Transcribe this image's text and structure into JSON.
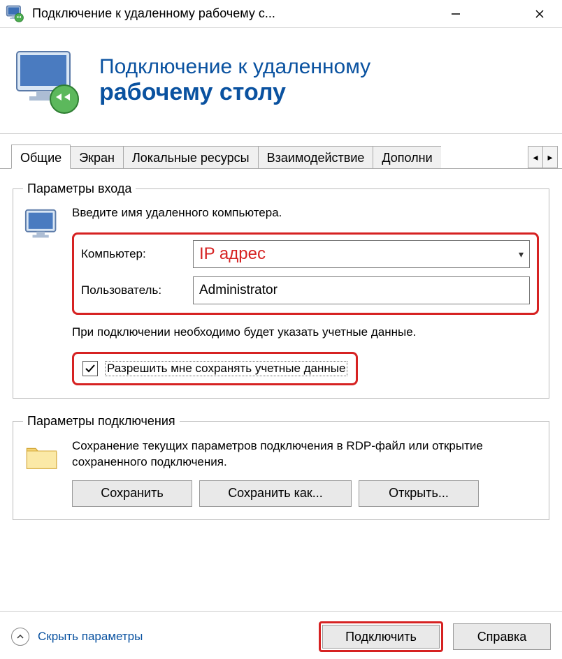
{
  "window": {
    "title": "Подключение к удаленному рабочему с..."
  },
  "header": {
    "line1": "Подключение к удаленному",
    "line2": "рабочему столу"
  },
  "tabs": [
    "Общие",
    "Экран",
    "Локальные ресурсы",
    "Взаимодействие",
    "Дополни"
  ],
  "login_group": {
    "legend": "Параметры входа",
    "instruction": "Введите имя удаленного компьютера.",
    "computer_label": "Компьютер:",
    "computer_value": "IP адрес",
    "user_label": "Пользователь:",
    "user_value": "Administrator",
    "note": "При подключении необходимо будет указать учетные данные.",
    "save_creds_label": "Разрешить мне сохранять учетные данные"
  },
  "conn_group": {
    "legend": "Параметры подключения",
    "desc": "Сохранение текущих параметров подключения в RDP-файл или открытие сохраненного подключения.",
    "save": "Сохранить",
    "save_as": "Сохранить как...",
    "open": "Открыть..."
  },
  "footer": {
    "hide": "Скрыть параметры",
    "connect": "Подключить",
    "help": "Справка"
  }
}
